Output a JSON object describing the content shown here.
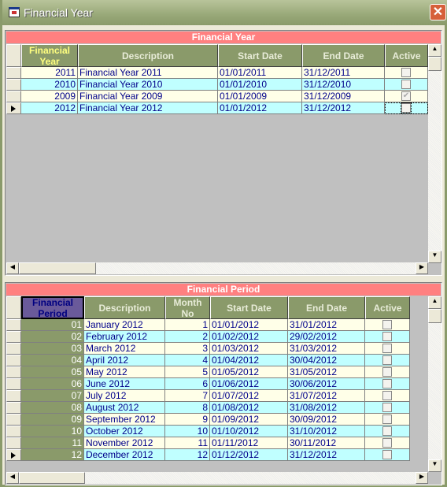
{
  "window": {
    "title": "Financial Year",
    "close_label": "✕"
  },
  "year_grid": {
    "title": "Financial Year",
    "headers": [
      "Financial Year",
      "Description",
      "Start Date",
      "End Date",
      "Active"
    ],
    "rows": [
      {
        "year": "2011",
        "description": "Financial Year 2011",
        "start": "01/01/2011",
        "end": "31/12/2011",
        "active": false
      },
      {
        "year": "2010",
        "description": "Financial Year 2010",
        "start": "01/01/2010",
        "end": "31/12/2010",
        "active": false
      },
      {
        "year": "2009",
        "description": "Financial Year 2009",
        "start": "01/01/2009",
        "end": "31/12/2009",
        "active": true
      },
      {
        "year": "2012",
        "description": "Financial Year 2012",
        "start": "01/01/2012",
        "end": "31/12/2012",
        "active": false
      }
    ],
    "current_row": 3
  },
  "period_grid": {
    "title": "Financial Period",
    "headers": [
      "Financial Period",
      "Description",
      "Month No",
      "Start Date",
      "End Date",
      "Active"
    ],
    "rows": [
      {
        "period": "01",
        "description": "January 2012",
        "month": "1",
        "start": "01/01/2012",
        "end": "31/01/2012",
        "active": false
      },
      {
        "period": "02",
        "description": "February 2012",
        "month": "2",
        "start": "01/02/2012",
        "end": "29/02/2012",
        "active": false
      },
      {
        "period": "03",
        "description": "March 2012",
        "month": "3",
        "start": "01/03/2012",
        "end": "31/03/2012",
        "active": false
      },
      {
        "period": "04",
        "description": "April 2012",
        "month": "4",
        "start": "01/04/2012",
        "end": "30/04/2012",
        "active": false
      },
      {
        "period": "05",
        "description": "May 2012",
        "month": "5",
        "start": "01/05/2012",
        "end": "31/05/2012",
        "active": false
      },
      {
        "period": "06",
        "description": "June 2012",
        "month": "6",
        "start": "01/06/2012",
        "end": "30/06/2012",
        "active": false
      },
      {
        "period": "07",
        "description": "July 2012",
        "month": "7",
        "start": "01/07/2012",
        "end": "31/07/2012",
        "active": false
      },
      {
        "period": "08",
        "description": "August 2012",
        "month": "8",
        "start": "01/08/2012",
        "end": "31/08/2012",
        "active": false
      },
      {
        "period": "09",
        "description": "September 2012",
        "month": "9",
        "start": "01/09/2012",
        "end": "30/09/2012",
        "active": false
      },
      {
        "period": "10",
        "description": "October 2012",
        "month": "10",
        "start": "01/10/2012",
        "end": "31/10/2012",
        "active": false
      },
      {
        "period": "11",
        "description": "November 2012",
        "month": "11",
        "start": "01/11/2012",
        "end": "30/11/2012",
        "active": false
      },
      {
        "period": "12",
        "description": "December 2012",
        "month": "12",
        "start": "01/12/2012",
        "end": "31/12/2012",
        "active": false
      }
    ],
    "current_row": 11
  },
  "colors": {
    "band": "#ff8080",
    "header": "#8a9a6a",
    "row_odd": "#ffffe8",
    "row_even": "#c0ffff",
    "key_header": "#6a5a9a",
    "year_header_text": "#ffff80"
  }
}
